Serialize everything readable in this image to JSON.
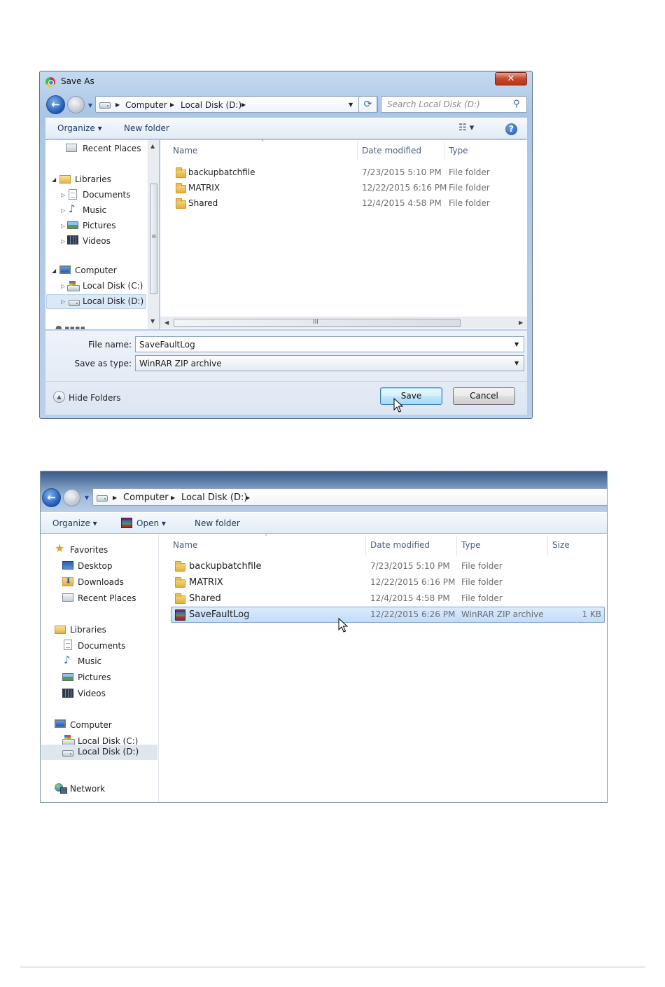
{
  "save_dialog": {
    "title": "Save As",
    "close_label": "✕",
    "breadcrumb": [
      "Computer",
      "Local Disk (D:)"
    ],
    "search_placeholder": "Search Local Disk (D:)",
    "toolbar": {
      "organize": "Organize",
      "new_folder": "New folder"
    },
    "nav_pane": {
      "recent_places": "Recent Places",
      "libraries": "Libraries",
      "library_items": [
        "Documents",
        "Music",
        "Pictures",
        "Videos"
      ],
      "computer": "Computer",
      "drives": [
        "Local Disk (C:)",
        "Local Disk (D:)"
      ]
    },
    "columns": [
      "Name",
      "Date modified",
      "Type"
    ],
    "rows": [
      {
        "name": "backupbatchfile",
        "date": "7/23/2015 5:10 PM",
        "type": "File folder"
      },
      {
        "name": "MATRIX",
        "date": "12/22/2015 6:16 PM",
        "type": "File folder"
      },
      {
        "name": "Shared",
        "date": "12/4/2015 4:58 PM",
        "type": "File folder"
      }
    ],
    "file_name_label": "File name:",
    "file_name_value": "SaveFaultLog",
    "save_type_label": "Save as type:",
    "save_type_value": "WinRAR ZIP archive",
    "hide_folders": "Hide Folders",
    "save_button": "Save",
    "cancel_button": "Cancel",
    "scroll_grip": "III",
    "nav_scroll_grip": "≡"
  },
  "explorer": {
    "breadcrumb": [
      "Computer",
      "Local Disk (D:)"
    ],
    "toolbar": {
      "organize": "Organize",
      "open": "Open",
      "new_folder": "New folder"
    },
    "nav_pane": {
      "favorites": "Favorites",
      "favorite_items": [
        "Desktop",
        "Downloads",
        "Recent Places"
      ],
      "libraries": "Libraries",
      "library_items": [
        "Documents",
        "Music",
        "Pictures",
        "Videos"
      ],
      "computer": "Computer",
      "drives": [
        "Local Disk (C:)",
        "Local Disk (D:)"
      ],
      "network": "Network"
    },
    "columns": [
      "Name",
      "Date modified",
      "Type",
      "Size"
    ],
    "rows": [
      {
        "name": "backupbatchfile",
        "date": "7/23/2015 5:10 PM",
        "type": "File folder",
        "size": ""
      },
      {
        "name": "MATRIX",
        "date": "12/22/2015 6:16 PM",
        "type": "File folder",
        "size": ""
      },
      {
        "name": "Shared",
        "date": "12/4/2015 4:58 PM",
        "type": "File folder",
        "size": ""
      },
      {
        "name": "SaveFaultLog",
        "date": "12/22/2015 6:26 PM",
        "type": "WinRAR ZIP archive",
        "size": "1 KB"
      }
    ]
  },
  "colors": {
    "dialog_frame": "#aac6e6",
    "selection": "#c1dcfc",
    "save_button": "#bee6fd"
  }
}
